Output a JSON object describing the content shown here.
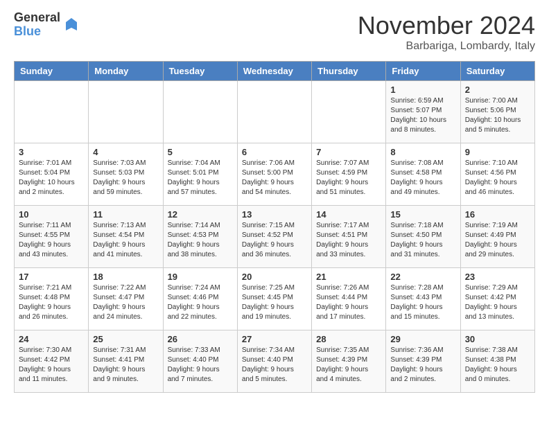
{
  "logo": {
    "general": "General",
    "blue": "Blue"
  },
  "header": {
    "month": "November 2024",
    "location": "Barbariga, Lombardy, Italy"
  },
  "weekdays": [
    "Sunday",
    "Monday",
    "Tuesday",
    "Wednesday",
    "Thursday",
    "Friday",
    "Saturday"
  ],
  "weeks": [
    [
      {
        "day": "",
        "info": ""
      },
      {
        "day": "",
        "info": ""
      },
      {
        "day": "",
        "info": ""
      },
      {
        "day": "",
        "info": ""
      },
      {
        "day": "",
        "info": ""
      },
      {
        "day": "1",
        "info": "Sunrise: 6:59 AM\nSunset: 5:07 PM\nDaylight: 10 hours and 8 minutes."
      },
      {
        "day": "2",
        "info": "Sunrise: 7:00 AM\nSunset: 5:06 PM\nDaylight: 10 hours and 5 minutes."
      }
    ],
    [
      {
        "day": "3",
        "info": "Sunrise: 7:01 AM\nSunset: 5:04 PM\nDaylight: 10 hours and 2 minutes."
      },
      {
        "day": "4",
        "info": "Sunrise: 7:03 AM\nSunset: 5:03 PM\nDaylight: 9 hours and 59 minutes."
      },
      {
        "day": "5",
        "info": "Sunrise: 7:04 AM\nSunset: 5:01 PM\nDaylight: 9 hours and 57 minutes."
      },
      {
        "day": "6",
        "info": "Sunrise: 7:06 AM\nSunset: 5:00 PM\nDaylight: 9 hours and 54 minutes."
      },
      {
        "day": "7",
        "info": "Sunrise: 7:07 AM\nSunset: 4:59 PM\nDaylight: 9 hours and 51 minutes."
      },
      {
        "day": "8",
        "info": "Sunrise: 7:08 AM\nSunset: 4:58 PM\nDaylight: 9 hours and 49 minutes."
      },
      {
        "day": "9",
        "info": "Sunrise: 7:10 AM\nSunset: 4:56 PM\nDaylight: 9 hours and 46 minutes."
      }
    ],
    [
      {
        "day": "10",
        "info": "Sunrise: 7:11 AM\nSunset: 4:55 PM\nDaylight: 9 hours and 43 minutes."
      },
      {
        "day": "11",
        "info": "Sunrise: 7:13 AM\nSunset: 4:54 PM\nDaylight: 9 hours and 41 minutes."
      },
      {
        "day": "12",
        "info": "Sunrise: 7:14 AM\nSunset: 4:53 PM\nDaylight: 9 hours and 38 minutes."
      },
      {
        "day": "13",
        "info": "Sunrise: 7:15 AM\nSunset: 4:52 PM\nDaylight: 9 hours and 36 minutes."
      },
      {
        "day": "14",
        "info": "Sunrise: 7:17 AM\nSunset: 4:51 PM\nDaylight: 9 hours and 33 minutes."
      },
      {
        "day": "15",
        "info": "Sunrise: 7:18 AM\nSunset: 4:50 PM\nDaylight: 9 hours and 31 minutes."
      },
      {
        "day": "16",
        "info": "Sunrise: 7:19 AM\nSunset: 4:49 PM\nDaylight: 9 hours and 29 minutes."
      }
    ],
    [
      {
        "day": "17",
        "info": "Sunrise: 7:21 AM\nSunset: 4:48 PM\nDaylight: 9 hours and 26 minutes."
      },
      {
        "day": "18",
        "info": "Sunrise: 7:22 AM\nSunset: 4:47 PM\nDaylight: 9 hours and 24 minutes."
      },
      {
        "day": "19",
        "info": "Sunrise: 7:24 AM\nSunset: 4:46 PM\nDaylight: 9 hours and 22 minutes."
      },
      {
        "day": "20",
        "info": "Sunrise: 7:25 AM\nSunset: 4:45 PM\nDaylight: 9 hours and 19 minutes."
      },
      {
        "day": "21",
        "info": "Sunrise: 7:26 AM\nSunset: 4:44 PM\nDaylight: 9 hours and 17 minutes."
      },
      {
        "day": "22",
        "info": "Sunrise: 7:28 AM\nSunset: 4:43 PM\nDaylight: 9 hours and 15 minutes."
      },
      {
        "day": "23",
        "info": "Sunrise: 7:29 AM\nSunset: 4:42 PM\nDaylight: 9 hours and 13 minutes."
      }
    ],
    [
      {
        "day": "24",
        "info": "Sunrise: 7:30 AM\nSunset: 4:42 PM\nDaylight: 9 hours and 11 minutes."
      },
      {
        "day": "25",
        "info": "Sunrise: 7:31 AM\nSunset: 4:41 PM\nDaylight: 9 hours and 9 minutes."
      },
      {
        "day": "26",
        "info": "Sunrise: 7:33 AM\nSunset: 4:40 PM\nDaylight: 9 hours and 7 minutes."
      },
      {
        "day": "27",
        "info": "Sunrise: 7:34 AM\nSunset: 4:40 PM\nDaylight: 9 hours and 5 minutes."
      },
      {
        "day": "28",
        "info": "Sunrise: 7:35 AM\nSunset: 4:39 PM\nDaylight: 9 hours and 4 minutes."
      },
      {
        "day": "29",
        "info": "Sunrise: 7:36 AM\nSunset: 4:39 PM\nDaylight: 9 hours and 2 minutes."
      },
      {
        "day": "30",
        "info": "Sunrise: 7:38 AM\nSunset: 4:38 PM\nDaylight: 9 hours and 0 minutes."
      }
    ]
  ]
}
